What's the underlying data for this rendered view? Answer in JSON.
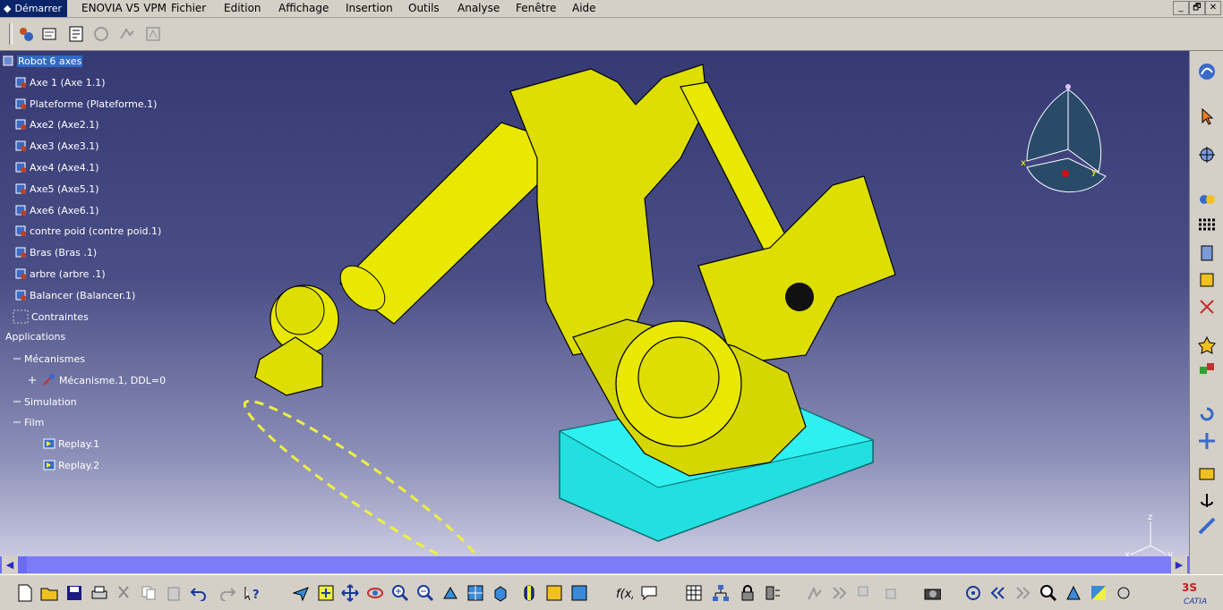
{
  "menubar": {
    "start": "Démarrer",
    "items": [
      "ENOVIA V5 VPM",
      "Fichier",
      "Edition",
      "Affichage",
      "Insertion",
      "Outils",
      "Analyse",
      "Fenêtre",
      "Aide"
    ],
    "window_controls": [
      "_",
      "🗗",
      "✕"
    ]
  },
  "tree": {
    "root": "Robot 6 axes",
    "parts": [
      "Axe 1 (Axe 1.1)",
      "Plateforme (Plateforme.1)",
      "Axe2 (Axe2.1)",
      "Axe3 (Axe3.1)",
      "Axe4 (Axe4.1)",
      "Axe5 (Axe5.1)",
      "Axe6 (Axe6.1)",
      "contre poid (contre poid.1)",
      "Bras  (Bras .1)",
      "arbre  (arbre .1)",
      "Balancer (Balancer.1)"
    ],
    "constraints": "Contraintes",
    "applications": "Applications",
    "mechanisms": "Mécanismes",
    "mechanism_item": "Mécanisme.1, DDL=0",
    "simulation": "Simulation",
    "film": "Film",
    "replays": [
      "Replay.1",
      "Replay.2"
    ]
  },
  "compass": {
    "x": "x",
    "y": "y"
  },
  "axes": {
    "x": "x",
    "y": "y",
    "z": "z"
  },
  "logo": {
    "text": "CATIA"
  },
  "colors": {
    "viewport_top": "#363a74",
    "part": "#e8e800",
    "base": "#22e0e0",
    "selection": "#316ac5"
  }
}
